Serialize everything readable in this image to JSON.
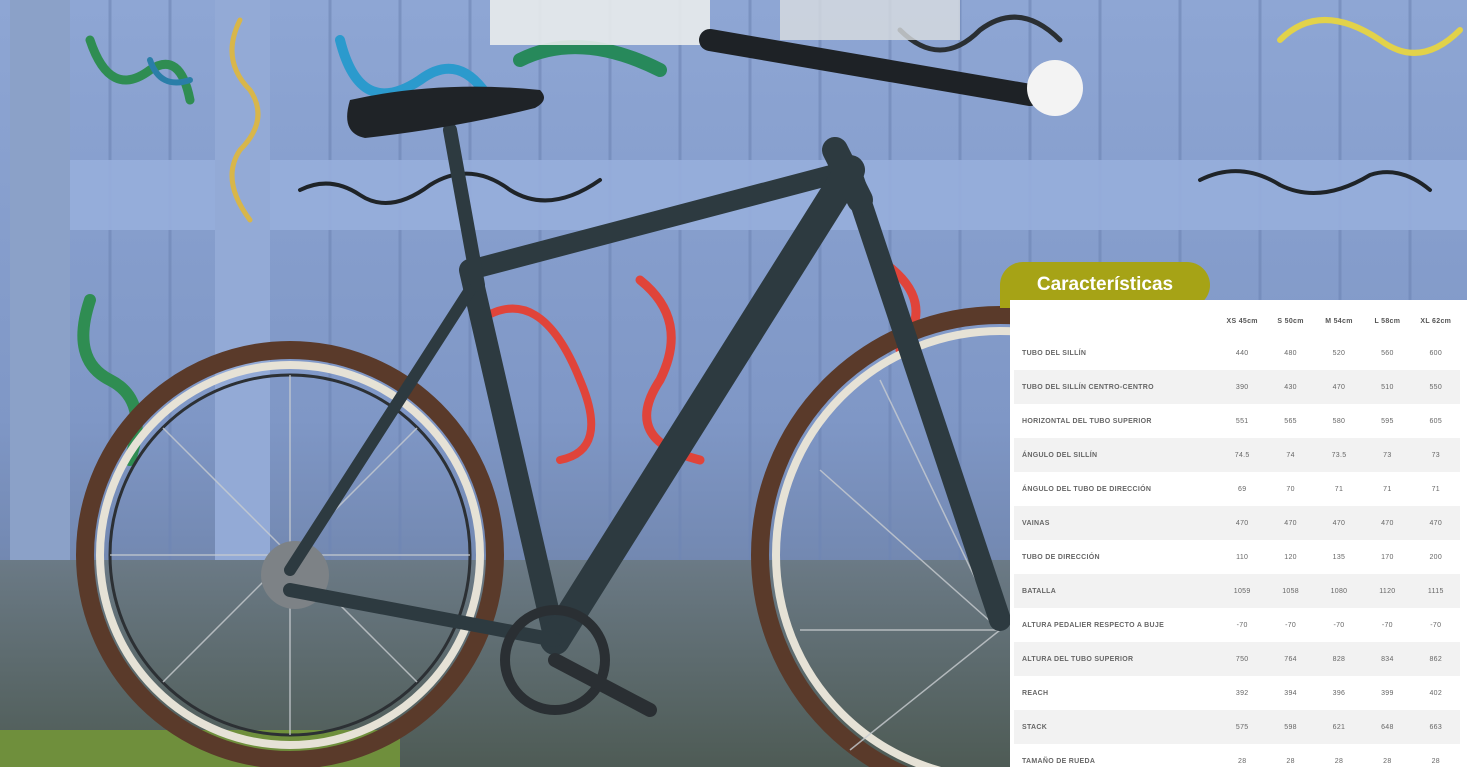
{
  "badge": {
    "title": "Características"
  },
  "geometry": {
    "sizes": [
      "XS 45cm",
      "S 50cm",
      "M 54cm",
      "L 58cm",
      "XL 62cm"
    ],
    "rows": [
      {
        "label": "TUBO DEL SILLÍN",
        "values": [
          "440",
          "480",
          "520",
          "560",
          "600"
        ]
      },
      {
        "label": "TUBO DEL SILLÍN CENTRO-CENTRO",
        "values": [
          "390",
          "430",
          "470",
          "510",
          "550"
        ]
      },
      {
        "label": "HORIZONTAL DEL TUBO SUPERIOR",
        "values": [
          "551",
          "565",
          "580",
          "595",
          "605"
        ]
      },
      {
        "label": "ÁNGULO DEL SILLÍN",
        "values": [
          "74.5",
          "74",
          "73.5",
          "73",
          "73"
        ]
      },
      {
        "label": "ÁNGULO DEL TUBO DE DIRECCIÓN",
        "values": [
          "69",
          "70",
          "71",
          "71",
          "71"
        ]
      },
      {
        "label": "VAINAS",
        "values": [
          "470",
          "470",
          "470",
          "470",
          "470"
        ]
      },
      {
        "label": "TUBO DE DIRECCIÓN",
        "values": [
          "110",
          "120",
          "135",
          "170",
          "200"
        ]
      },
      {
        "label": "BATALLA",
        "values": [
          "1059",
          "1058",
          "1080",
          "1120",
          "1115"
        ]
      },
      {
        "label": "ALTURA PEDALIER RESPECTO A BUJE",
        "values": [
          "-70",
          "-70",
          "-70",
          "-70",
          "-70"
        ]
      },
      {
        "label": "ALTURA DEL TUBO SUPERIOR",
        "values": [
          "750",
          "764",
          "828",
          "834",
          "862"
        ]
      },
      {
        "label": "REACH",
        "values": [
          "392",
          "394",
          "396",
          "399",
          "402"
        ]
      },
      {
        "label": "STACK",
        "values": [
          "575",
          "598",
          "621",
          "648",
          "663"
        ]
      },
      {
        "label": "TAMAÑO DE RUEDA",
        "values": [
          "28",
          "28",
          "28",
          "28",
          "28"
        ]
      }
    ]
  }
}
